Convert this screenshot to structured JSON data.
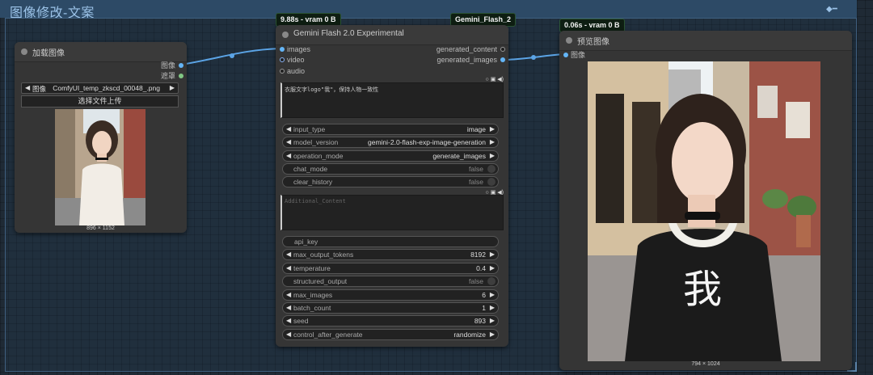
{
  "group": {
    "title": "图像修改-文案"
  },
  "load_node": {
    "title": "加载图像",
    "outputs": [
      "图像",
      "遮罩"
    ],
    "image_widget": {
      "label": "图像",
      "value": "ComfyUI_temp_zkscd_00048_.png"
    },
    "upload_button": "选择文件上传",
    "dimensions": "896 × 1152"
  },
  "gemini_node": {
    "badge_time": "9.88s - vram 0 B",
    "badge_title": "Gemini_Flash_2",
    "title": "Gemini Flash 2.0 Experimental",
    "inputs": [
      "images",
      "video",
      "audio"
    ],
    "outputs": [
      "generated_content",
      "generated_images"
    ],
    "prompt_text": "衣服文字logo\"我\"，保持人物一致性",
    "additional_placeholder": "Additional_Content",
    "widgets": [
      {
        "type": "combo",
        "label": "input_type",
        "value": "image"
      },
      {
        "type": "combo",
        "label": "model_version",
        "value": "gemini-2.0-flash-exp-image-generation"
      },
      {
        "type": "combo",
        "label": "operation_mode",
        "value": "generate_images"
      },
      {
        "type": "toggle",
        "label": "chat_mode",
        "value": "false"
      },
      {
        "type": "toggle",
        "label": "clear_history",
        "value": "false"
      }
    ],
    "widgets2": [
      {
        "type": "text",
        "label": "api_key",
        "value": ""
      },
      {
        "type": "combo",
        "label": "max_output_tokens",
        "value": "8192"
      },
      {
        "type": "combo",
        "label": "temperature",
        "value": "0.4"
      },
      {
        "type": "toggle",
        "label": "structured_output",
        "value": "false"
      },
      {
        "type": "combo",
        "label": "max_images",
        "value": "6"
      },
      {
        "type": "combo",
        "label": "batch_count",
        "value": "1"
      },
      {
        "type": "combo",
        "label": "seed",
        "value": "893"
      },
      {
        "type": "combo",
        "label": "control_after_generate",
        "value": "randomize"
      }
    ]
  },
  "preview_node": {
    "badge_time": "0.06s - vram 0 B",
    "title": "预览图像",
    "input": "图像",
    "shirt_text": "我",
    "dimensions": "794 × 1024"
  },
  "colors": {
    "link": "#5ba4e6",
    "image_pin": "#64b5f6",
    "mask_pin": "#81c784"
  }
}
